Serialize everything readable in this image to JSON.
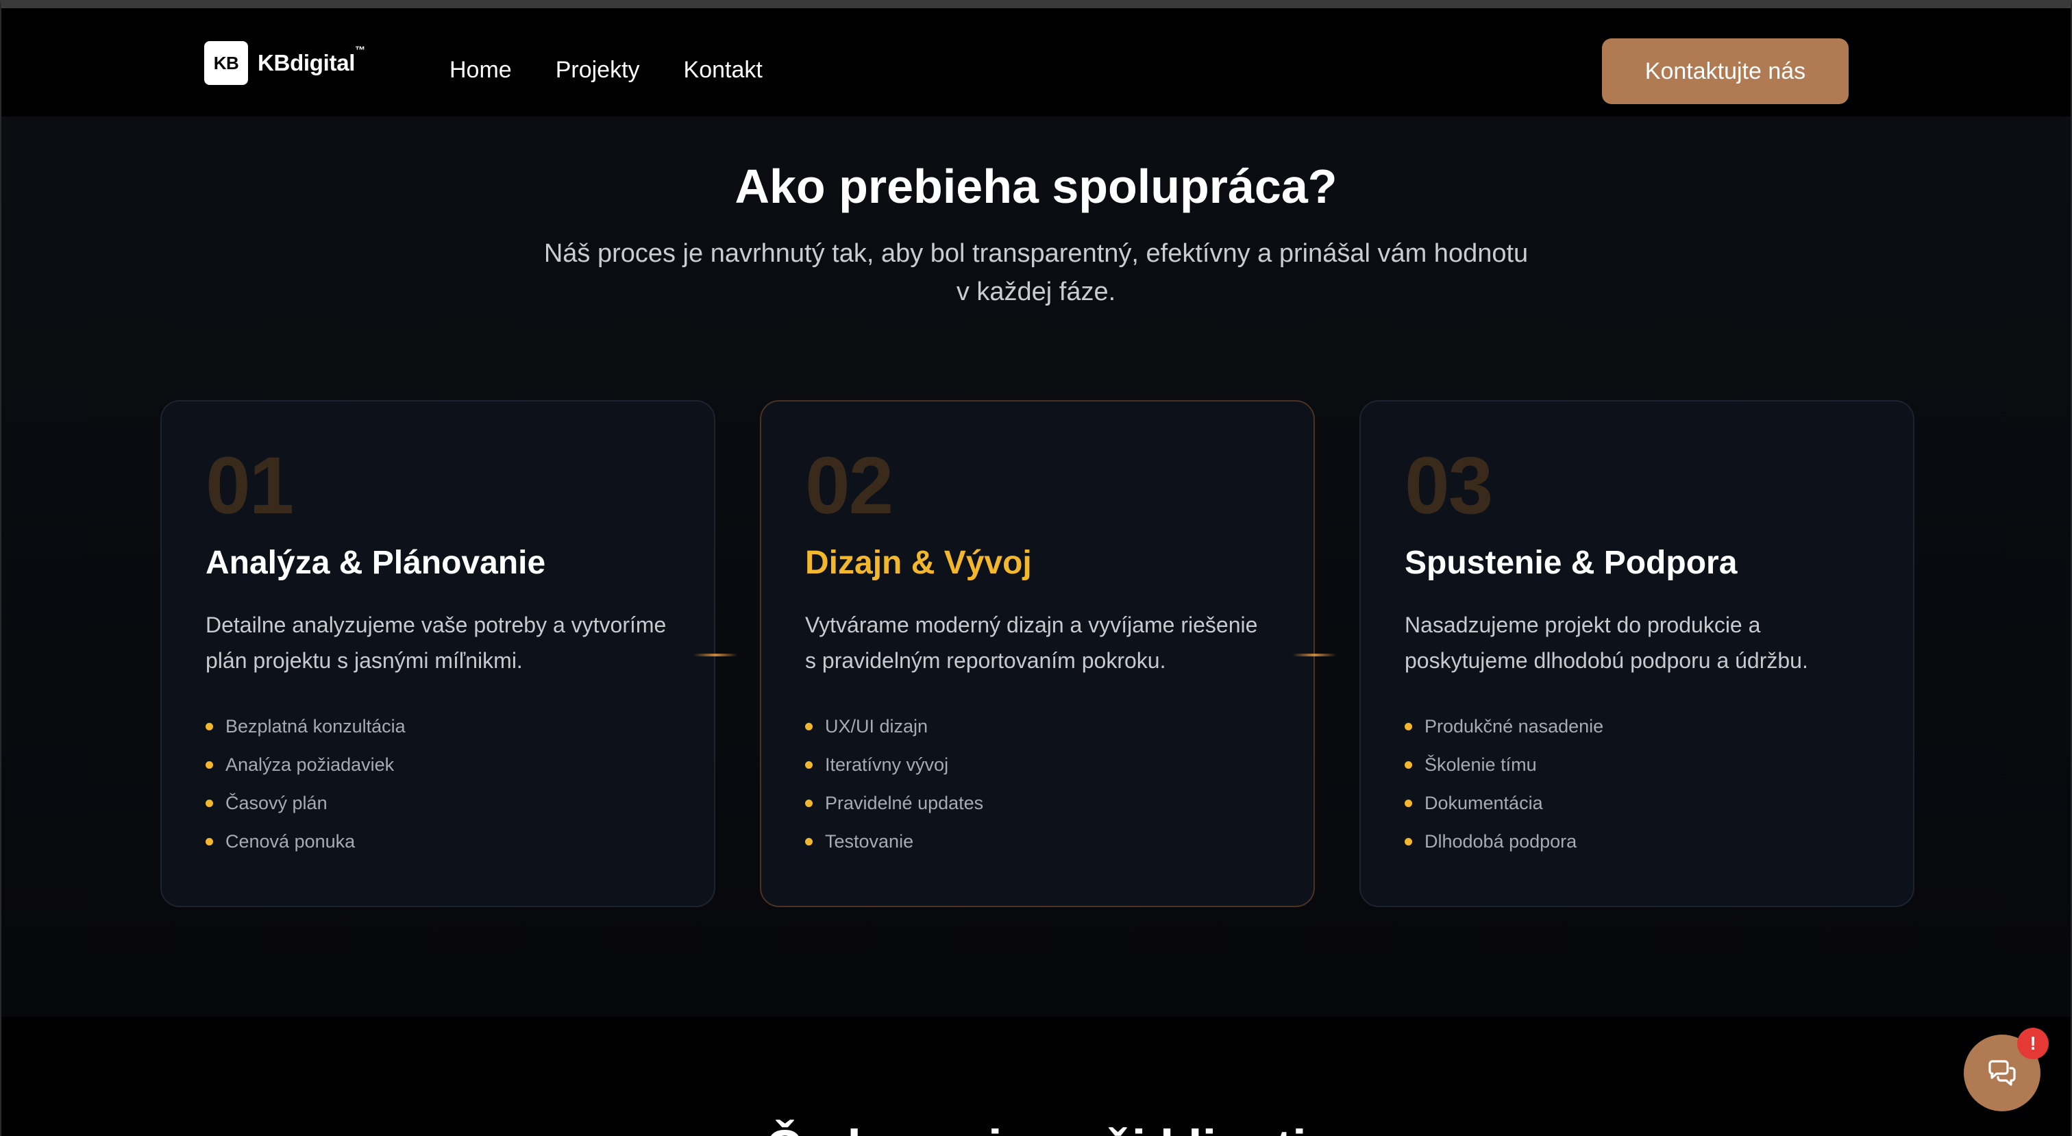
{
  "nav": {
    "logo_mark": "KB",
    "logo_text": "KBdigital",
    "logo_tm": "™",
    "links": [
      "Home",
      "Projekty",
      "Kontakt"
    ],
    "cta_label": "Kontaktujte nás"
  },
  "process": {
    "title": "Ako prebieha spolupráca?",
    "subtitle_line1": "Náš proces je navrhnutý tak, aby bol transparentný, efektívny a prinášal vám hodnotu",
    "subtitle_line2": "v každej fáze.",
    "steps": [
      {
        "number": "01",
        "title": "Analýza & Plánovanie",
        "desc_line1": "Detailne analyzujeme vaše potreby a vytvoríme",
        "desc_line2": "plán projektu s jasnými míľnikmi.",
        "items": [
          "Bezplatná konzultácia",
          "Analýza požiadaviek",
          "Časový plán",
          "Cenová ponuka"
        ]
      },
      {
        "number": "02",
        "title": "Dizajn & Vývoj",
        "desc_line1": "Vytvárame moderný dizajn a vyvíjame riešenie",
        "desc_line2": "s pravidelným reportovaním pokroku.",
        "items": [
          "UX/UI dizajn",
          "Iteratívny vývoj",
          "Pravidelné updates",
          "Testovanie"
        ]
      },
      {
        "number": "03",
        "title": "Spustenie & Podpora",
        "desc_line1": "Nasadzujeme projekt do produkcie a",
        "desc_line2": "poskytujeme dlhodobú podporu a údržbu.",
        "items": [
          "Produkčné nasadenie",
          "Školenie tímu",
          "Dokumentácia",
          "Dlhodobá podpora"
        ]
      }
    ]
  },
  "next_section": {
    "title_partial": "Čo hovoria naši klienti"
  },
  "chat": {
    "badge": "!",
    "icon": "chat-bubbles-icon"
  },
  "colors": {
    "accent": "#b07a52",
    "highlight": "#f2b72c",
    "badge": "#e53935"
  }
}
